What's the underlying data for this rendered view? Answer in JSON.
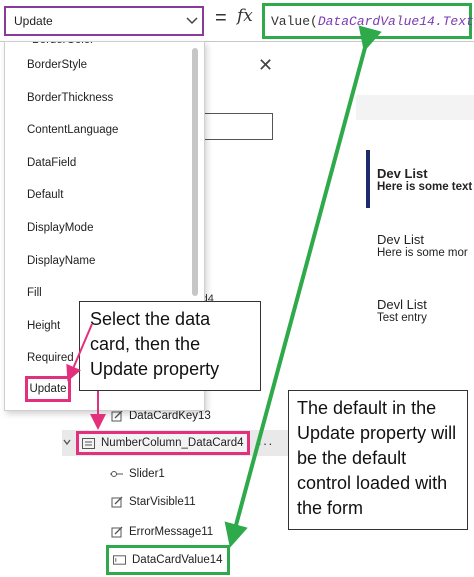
{
  "formula_bar": {
    "selected_property": "Update",
    "equals": "=",
    "fx": "fx",
    "formula_fn": "Value(",
    "formula_arg": "DataCardValue14.Text",
    "formula_close": ")"
  },
  "property_dropdown": {
    "items": [
      "BorderStyle",
      "BorderThickness",
      "ContentLanguage",
      "DataField",
      "Default",
      "DisplayMode",
      "DisplayName",
      "Fill",
      "Height",
      "Required"
    ],
    "highlighted_item": "Update"
  },
  "tree": {
    "partial_text": "rd4",
    "rows": {
      "datacardkey13": "DataCardKey13",
      "numbercolumn": "NumberColumn_DataCard4",
      "slider1": "Slider1",
      "starvisible11": "StarVisible11",
      "errormessage11": "ErrorMessage11",
      "datacardvalue14": "DataCardValue14"
    },
    "more_label": "···"
  },
  "preview": {
    "items": [
      {
        "title": "Dev List",
        "subtitle": "Here is some text"
      },
      {
        "title": "Dev List",
        "subtitle": "Here is some mor"
      },
      {
        "title": "Devl List",
        "subtitle": "Test entry"
      }
    ]
  },
  "callouts": {
    "select_card": "Select the data card, then the Update property",
    "default_note": "The default in the Update property will be the default control loaded with the form"
  },
  "colors": {
    "green_highlight": "#2eaa4a",
    "pink_highlight": "#e2307c",
    "purple_border": "#8a3a9a",
    "selection_bar": "#1f2a6b"
  }
}
